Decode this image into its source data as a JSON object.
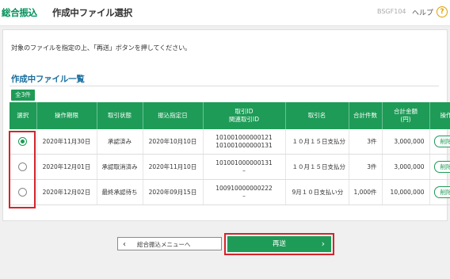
{
  "header": {
    "brand": "総合振込",
    "title": "作成中ファイル選択",
    "screen_id": "BSGF104",
    "help_label": "ヘルプ",
    "help_icon": "?"
  },
  "instruction": "対象のファイルを指定の上、「再送」ボタンを押してください。",
  "section_title": "作成中ファイル一覧",
  "count_badge": "全3件",
  "table": {
    "headers": [
      "選択",
      "操作期限",
      "取引状態",
      "振込指定日",
      "取引ID\n関連取引ID",
      "取引名",
      "合計件数",
      "合計金額\n(円)",
      "操作"
    ],
    "rows": [
      {
        "selected": true,
        "deadline": "2020年11月30日",
        "status": "承認済み",
        "transfer_date": "2020年10月10日",
        "txn_id": "101001000000121",
        "related_id": "101001000000131",
        "name": "１０月１５日支払分",
        "count": "3件",
        "amount": "3,000,000",
        "action": "削除"
      },
      {
        "selected": false,
        "deadline": "2020年12月01日",
        "status": "承認取消済み",
        "transfer_date": "2020年11月10日",
        "txn_id": "101001000000131",
        "related_id": "–",
        "name": "１０月１５日支払分",
        "count": "3件",
        "amount": "3,000,000",
        "action": "削除"
      },
      {
        "selected": false,
        "deadline": "2020年12月02日",
        "status": "最終承認待ち",
        "transfer_date": "2020年09月15日",
        "txn_id": "100910000000222",
        "related_id": "–",
        "name": "9月１０日支払い分",
        "count": "1,000件",
        "amount": "10,000,000",
        "action": "削除"
      }
    ]
  },
  "buttons": {
    "back_label": "総合振込メニューへ",
    "resend_label": "再送"
  },
  "colors": {
    "brand": "#00915a",
    "accent": "#1e9b57",
    "highlight": "#d6232a",
    "section_title": "#1a6e9e"
  }
}
